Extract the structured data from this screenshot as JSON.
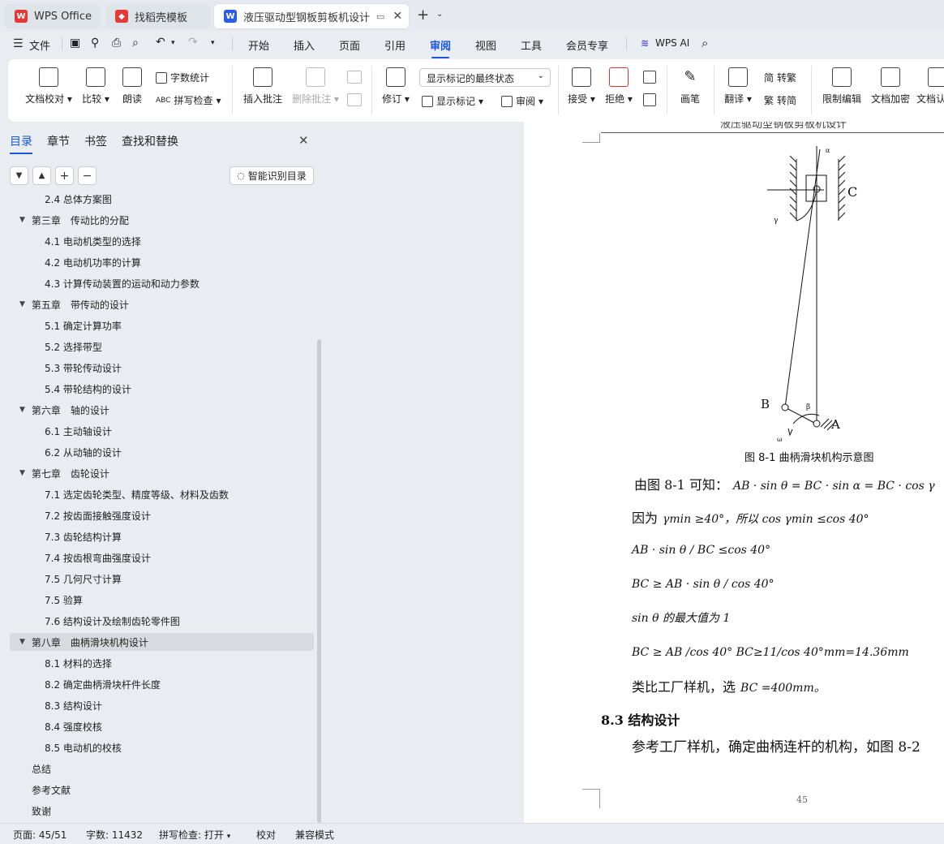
{
  "tabs": [
    {
      "label": "WPS Office",
      "icon": "wps-logo-icon",
      "color": "#e53935"
    },
    {
      "label": "找稻壳模板",
      "icon": "docer-icon",
      "color": "#e53935"
    },
    {
      "label": "液压驱动型钢板剪板机设计 说",
      "icon": "word-doc-icon",
      "color": "#2b5ce6"
    }
  ],
  "menu": {
    "file": "文件",
    "items": [
      "开始",
      "插入",
      "页面",
      "引用",
      "审阅",
      "视图",
      "工具",
      "会员专享"
    ],
    "active": "审阅",
    "ai": "WPS AI"
  },
  "ribbon": {
    "doc_check": "文档校对",
    "compare": "比较",
    "read_aloud": "朗读",
    "word_count": "字数统计",
    "spell_check": "拼写检查",
    "insert_comment": "插入批注",
    "delete_comment": "删除批注",
    "track": "修订",
    "markup_state": "显示标记的最终状态",
    "show_markup": "显示标记",
    "review": "审阅",
    "accept": "接受",
    "reject": "拒绝",
    "ink": "画笔",
    "translate": "翻译",
    "to_traditional": "转繁",
    "to_simplified": "转简",
    "restrict_edit": "限制编辑",
    "encrypt": "文档加密",
    "doc_auth": "文档认"
  },
  "sidebar": {
    "tabs": [
      "目录",
      "章节",
      "书签",
      "查找和替换"
    ],
    "smart_toc": "智能识别目录",
    "items": [
      {
        "label": "2.4 总体方案图",
        "level": 2
      },
      {
        "label": "第三章　传动比的分配",
        "level": 1
      },
      {
        "label": "4.1 电动机类型的选择",
        "level": 2
      },
      {
        "label": "4.2 电动机功率的计算",
        "level": 2
      },
      {
        "label": "4.3 计算传动装置的运动和动力参数",
        "level": 2
      },
      {
        "label": "第五章　带传动的设计",
        "level": 1
      },
      {
        "label": "5.1 确定计算功率",
        "level": 2
      },
      {
        "label": "5.2 选择带型",
        "level": 2
      },
      {
        "label": "5.3 带轮传动设计",
        "level": 2
      },
      {
        "label": "5.4 带轮结构的设计",
        "level": 2
      },
      {
        "label": "第六章　轴的设计",
        "level": 1
      },
      {
        "label": "6.1 主动轴设计",
        "level": 2
      },
      {
        "label": "6.2 从动轴的设计",
        "level": 2
      },
      {
        "label": "第七章　齿轮设计",
        "level": 1
      },
      {
        "label": "7.1 选定齿轮类型、精度等级、材料及齿数",
        "level": 2
      },
      {
        "label": "7.2 按齿面接触强度设计",
        "level": 2
      },
      {
        "label": "7.3 齿轮结构计算",
        "level": 2
      },
      {
        "label": "7.4 按齿根弯曲强度设计",
        "level": 2
      },
      {
        "label": "7.5 几何尺寸计算",
        "level": 2
      },
      {
        "label": "7.5 验算",
        "level": 2
      },
      {
        "label": "7.6 结构设计及绘制齿轮零件图",
        "level": 2
      },
      {
        "label": "第八章　曲柄滑块机构设计",
        "level": 1,
        "selected": true
      },
      {
        "label": "8.1 材料的选择",
        "level": 2
      },
      {
        "label": "8.2 确定曲柄滑块杆件长度",
        "level": 2
      },
      {
        "label": "8.3 结构设计",
        "level": 2
      },
      {
        "label": "8.4 强度校核",
        "level": 2
      },
      {
        "label": "8.5 电动机的校核",
        "level": 2
      },
      {
        "label": "总结",
        "level": 0
      },
      {
        "label": "参考文献",
        "level": 0
      },
      {
        "label": "致谢",
        "level": 0
      }
    ]
  },
  "document": {
    "header": "液压驱动型钢板剪板机设计",
    "figure_labels": {
      "C": "C",
      "B": "B",
      "A": "A",
      "gamma": "γ",
      "beta": "β",
      "omega": "ω",
      "alpha": "α"
    },
    "caption": "图 8-1  曲柄滑块机构示意图",
    "lines": [
      {
        "pre": "由图 8-1 可知：",
        "math": "AB · sin θ = BC · sin α = BC · cos γ"
      },
      {
        "pre": "因为",
        "math": "γmin ≥40°，所以 cos γmin ≤cos 40°"
      },
      {
        "pre": "",
        "math": "AB · sin θ /  BC ≤cos 40°"
      },
      {
        "pre": "",
        "math": "BC ≥ AB · sin θ /  cos 40°"
      },
      {
        "pre": "",
        "math": "sin θ 的最大值为 1"
      },
      {
        "pre": "",
        "math": "BC ≥ AB /cos 40°     BC≥11/cos 40°mm=14.36mm"
      },
      {
        "pre": "类比工厂样机，选",
        "math": "BC =400mm。"
      }
    ],
    "section": "8.3 结构设计",
    "para": "参考工厂样机，确定曲柄连杆的机构，如图 8-2",
    "page_number": "45"
  },
  "status": {
    "page": "页面: 45/51",
    "words": "字数: 11432",
    "spell": "拼写检查: 打开",
    "proof": "校对",
    "compat": "兼容模式"
  }
}
